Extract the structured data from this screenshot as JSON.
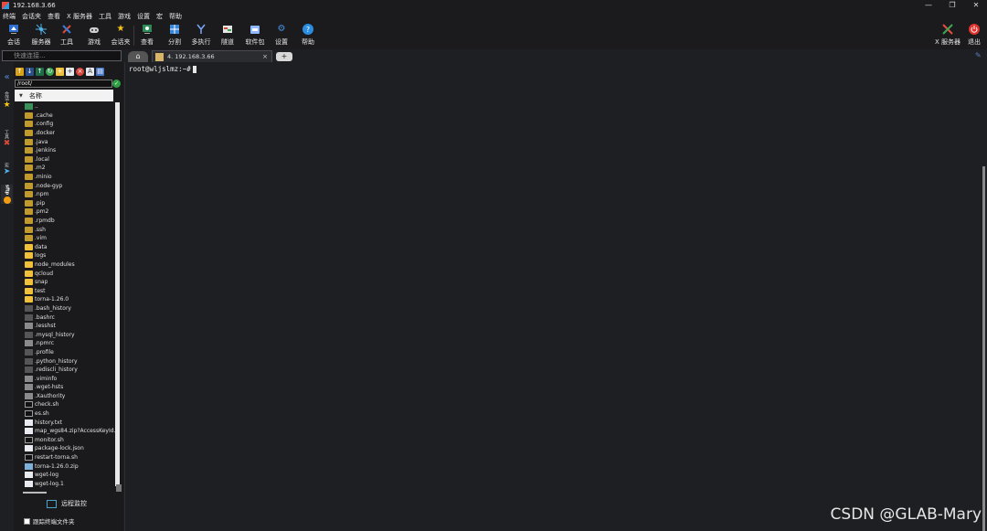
{
  "window": {
    "title": "192.168.3.66",
    "minimize": "—",
    "restore": "❐",
    "close": "✕"
  },
  "menu": [
    "终端",
    "会话夹",
    "查看",
    "X 服务器",
    "工具",
    "游戏",
    "设置",
    "宏",
    "帮助"
  ],
  "toolbar": {
    "items": [
      {
        "label": "会话",
        "icon": "session-icon"
      },
      {
        "label": "服务器",
        "icon": "servers-icon"
      },
      {
        "label": "工具",
        "icon": "tools-icon"
      },
      {
        "label": "游戏",
        "icon": "games-icon"
      },
      {
        "label": "会话夹",
        "icon": "star-icon"
      },
      {
        "label": "查看",
        "icon": "view-icon"
      },
      {
        "label": "分割",
        "icon": "split-icon"
      },
      {
        "label": "多执行",
        "icon": "multiexec-icon"
      },
      {
        "label": "隧道",
        "icon": "tunnel-icon"
      },
      {
        "label": "软件包",
        "icon": "packages-icon"
      },
      {
        "label": "设置",
        "icon": "gear-icon"
      },
      {
        "label": "帮助",
        "icon": "help-icon"
      }
    ],
    "right": [
      {
        "label": "X 服务器",
        "icon": "x-server-icon"
      },
      {
        "label": "退出",
        "icon": "power-icon"
      }
    ]
  },
  "quick_connect": {
    "placeholder": "快速连接..."
  },
  "tabs": {
    "session_title": "4. 192.168.3.66",
    "close": "×",
    "add": "+"
  },
  "left_strip": [
    "会话",
    "工具",
    "宏",
    "sftp"
  ],
  "sftp": {
    "path": "/root/",
    "column_name": "名称",
    "files": [
      {
        "name": "..",
        "type": "up"
      },
      {
        "name": ".cache",
        "type": "folder"
      },
      {
        "name": ".config",
        "type": "folder"
      },
      {
        "name": ".docker",
        "type": "folder"
      },
      {
        "name": ".java",
        "type": "folder"
      },
      {
        "name": ".jenkins",
        "type": "folder"
      },
      {
        "name": ".local",
        "type": "folder"
      },
      {
        "name": ".m2",
        "type": "folder"
      },
      {
        "name": ".minio",
        "type": "folder"
      },
      {
        "name": ".node-gyp",
        "type": "folder"
      },
      {
        "name": ".npm",
        "type": "folder"
      },
      {
        "name": ".pip",
        "type": "folder"
      },
      {
        "name": ".pm2",
        "type": "folder"
      },
      {
        "name": ".rpmdb",
        "type": "folder"
      },
      {
        "name": ".ssh",
        "type": "folder"
      },
      {
        "name": ".vim",
        "type": "folder"
      },
      {
        "name": "data",
        "type": "folder-plain"
      },
      {
        "name": "logs",
        "type": "folder-plain"
      },
      {
        "name": "node_modules",
        "type": "folder-plain"
      },
      {
        "name": "qcloud",
        "type": "folder-plain"
      },
      {
        "name": "snap",
        "type": "folder-plain"
      },
      {
        "name": "test",
        "type": "folder-plain"
      },
      {
        "name": "torna-1.26.0",
        "type": "folder-plain"
      },
      {
        "name": ".bash_history",
        "type": "file"
      },
      {
        "name": ".bashrc",
        "type": "file"
      },
      {
        "name": ".lesshst",
        "type": "hidden-doc"
      },
      {
        "name": ".mysql_history",
        "type": "file"
      },
      {
        "name": ".npmrc",
        "type": "hidden-doc"
      },
      {
        "name": ".profile",
        "type": "file"
      },
      {
        "name": ".python_history",
        "type": "file"
      },
      {
        "name": ".rediscli_history",
        "type": "file"
      },
      {
        "name": ".viminfo",
        "type": "hidden-doc"
      },
      {
        "name": ".wget-hsts",
        "type": "hidden-doc"
      },
      {
        "name": ".Xauthority",
        "type": "hidden-doc"
      },
      {
        "name": "check.sh",
        "type": "term"
      },
      {
        "name": "es.sh",
        "type": "term"
      },
      {
        "name": "history.txt",
        "type": "doc"
      },
      {
        "name": "map_wgs84.zip?AccessKeyId...",
        "type": "doc"
      },
      {
        "name": "monitor.sh",
        "type": "term"
      },
      {
        "name": "package-lock.json",
        "type": "doc"
      },
      {
        "name": "restart-torna.sh",
        "type": "term"
      },
      {
        "name": "torna-1.26.0.zip",
        "type": "zip"
      },
      {
        "name": "wget-log",
        "type": "doc"
      },
      {
        "name": "wget-log.1",
        "type": "doc"
      }
    ],
    "process_monitor": "远程监控",
    "follow_folder": "跟踪终端文件夹"
  },
  "terminal": {
    "prompt": "root@wljslmz:~#"
  },
  "watermark": "CSDN @GLAB-Mary"
}
